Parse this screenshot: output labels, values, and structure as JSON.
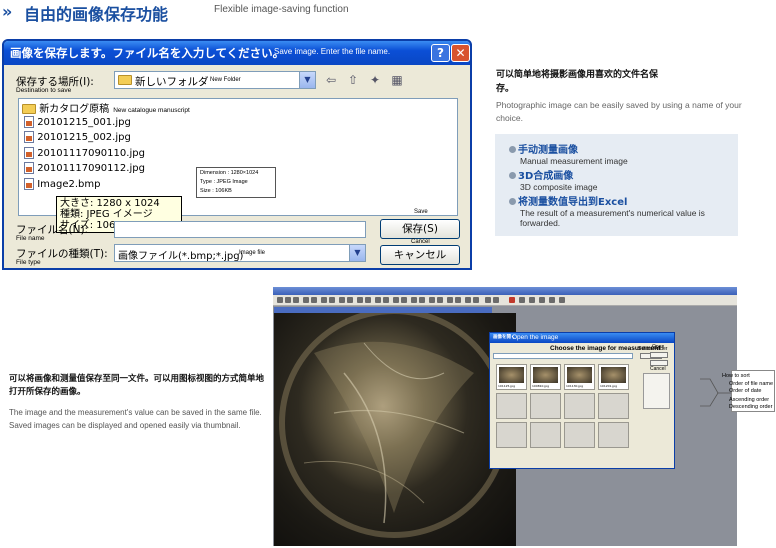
{
  "header": {
    "chevrons": "»",
    "title": "自由的画像保存功能",
    "subtitle": "Flexible image-saving function"
  },
  "save_dialog": {
    "title_jp": "画像を保存します。ファイル名を入力してください。",
    "title_en": "Save image. Enter the file name.",
    "help_label": "?",
    "close_label": "✕",
    "location_label": "保存する場所(I):",
    "location_label_en": "Destination to save",
    "location_value": "新しいフォルダ",
    "location_value_en": "New Folder",
    "files": [
      {
        "name": "新カタログ原稿",
        "note": "New catalogue manuscript",
        "type": "folder"
      },
      {
        "name": "20101215_001.jpg",
        "note": "",
        "type": "file"
      },
      {
        "name": "20101215_002.jpg",
        "note": "",
        "type": "file"
      },
      {
        "name": "20101117090110.jpg",
        "note": "",
        "type": "file"
      },
      {
        "name": "20101117090112.jpg",
        "note": "",
        "type": "file"
      },
      {
        "name": "Image2.bmp",
        "note": "",
        "type": "file"
      }
    ],
    "tooltip_en": [
      "Dimension : 1280×1024",
      "Type : JPEG Image",
      "Size : 106KB"
    ],
    "tooltip_jp": [
      "大きさ: 1280 x 1024",
      "種類: JPEG イメージ",
      "サイズ: 106 KB"
    ],
    "filename_label": "ファイル名(N):",
    "filename_label_en": "File name",
    "filename_value": "",
    "filetype_label": "ファイルの種類(T):",
    "filetype_label_en": "File type",
    "filetype_value": "画像ファイル(*.bmp;*.jpg)",
    "filetype_value_en": "Image file",
    "save_button": "保存(S)",
    "save_button_en": "Save",
    "cancel_button": "キャンセル",
    "cancel_button_en": "Cancel"
  },
  "feature_text": {
    "cn": "可以简单地将摄影画像用喜欢的文件名保存。",
    "en": "Photographic image can be easily saved by using a name of your choice.",
    "items": [
      {
        "title": "手动测量画像",
        "desc": "Manual measurement image"
      },
      {
        "title": "3D合成画像",
        "desc": "3D composite image"
      },
      {
        "title": "将测量数值导出到Excel",
        "desc": "The result of a measurement's numerical value is forwarded."
      }
    ]
  },
  "second_text": {
    "cn": "可以将画像和测量值保存至同一文件。可以用图标视图的方式简单地打开所保存的画像。",
    "en1": "The image and the measurement's value can be saved in the same file.",
    "en2": "Saved images can be displayed and opened easily via thumbnail."
  },
  "open_dialog": {
    "title_jp": "画像を開く",
    "title_en": "Open the image",
    "choose_label": "Choose the image for measurement",
    "select_folder": "Select Folder",
    "open_label": "Open",
    "cancel_label": "Cancel",
    "thumbs": [
      "101125.jpg",
      "100810.jpg",
      "101130.jpg",
      "101201.jpg"
    ]
  },
  "sort_callout": {
    "title": "How to sort",
    "items": [
      "Order of file name",
      "Order of date",
      "Ascending order",
      "Descending order"
    ]
  }
}
